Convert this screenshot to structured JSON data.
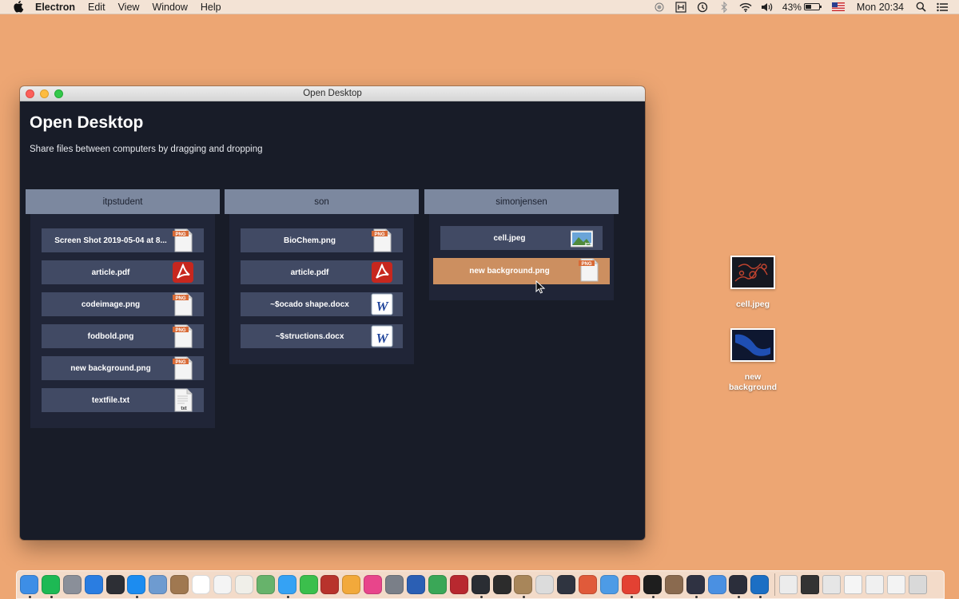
{
  "menubar": {
    "app_name": "Electron",
    "items": [
      "Edit",
      "View",
      "Window",
      "Help"
    ],
    "battery_percent": "43%",
    "battery_level": 0.43,
    "clock": "Mon 20:34",
    "status_icons": [
      "record-icon",
      "keyboard-icon",
      "time-machine-icon",
      "bluetooth-icon",
      "wifi-icon",
      "volume-icon"
    ]
  },
  "window": {
    "title": "Open Desktop",
    "heading": "Open Desktop",
    "subtitle": "Share files between computers by dragging and dropping"
  },
  "columns": [
    {
      "user": "itpstudent",
      "files": [
        {
          "name": "Screen Shot 2019-05-04 at 8...",
          "type": "png"
        },
        {
          "name": "article.pdf",
          "type": "pdf"
        },
        {
          "name": "codeimage.png",
          "type": "png"
        },
        {
          "name": "fodbold.png",
          "type": "png"
        },
        {
          "name": "new background.png",
          "type": "png"
        },
        {
          "name": "textfile.txt",
          "type": "txt"
        }
      ]
    },
    {
      "user": "son",
      "files": [
        {
          "name": "BioChem.png",
          "type": "png"
        },
        {
          "name": "article.pdf",
          "type": "pdf"
        },
        {
          "name": "~$ocado shape.docx",
          "type": "docx"
        },
        {
          "name": "~$structions.docx",
          "type": "docx"
        }
      ]
    },
    {
      "user": "simonjensen",
      "files": [
        {
          "name": "cell.jpeg",
          "type": "jpeg"
        },
        {
          "name": "new background.png",
          "type": "png",
          "dragging": true
        }
      ]
    }
  ],
  "icon_badges": {
    "png": "PNG",
    "txt": "txt",
    "docx": "W",
    "jpeg": "jpeg"
  },
  "desktop_icons": [
    {
      "label": "cell.jpeg",
      "kind": "image-thumbnail",
      "color": "#1b1e28"
    },
    {
      "label": "new background",
      "kind": "image-thumbnail",
      "color": "#13204a"
    }
  ],
  "dock": {
    "items": [
      {
        "name": "finder-icon",
        "color": "#3d8ee6",
        "running": true
      },
      {
        "name": "spotify-icon",
        "color": "#1db954",
        "running": true
      },
      {
        "name": "launchpad-icon",
        "color": "#8a8f99",
        "running": false
      },
      {
        "name": "safari-icon",
        "color": "#2a7de1",
        "running": false
      },
      {
        "name": "mission-control-icon",
        "color": "#2d2f35",
        "running": false
      },
      {
        "name": "safari-compass-icon",
        "color": "#1c8cf0",
        "running": true
      },
      {
        "name": "preview-icon",
        "color": "#6e9bd0",
        "running": false
      },
      {
        "name": "notes-icon",
        "color": "#a07850",
        "running": false
      },
      {
        "name": "calendar-icon",
        "color": "#ffffff",
        "running": false
      },
      {
        "name": "reminders-icon",
        "color": "#f4f4f4",
        "running": false
      },
      {
        "name": "stickies-icon",
        "color": "#f0efe9",
        "running": false
      },
      {
        "name": "maps-icon",
        "color": "#67b36b",
        "running": false
      },
      {
        "name": "messages-icon",
        "color": "#35a2f4",
        "running": true
      },
      {
        "name": "facetime-icon",
        "color": "#3bbf4c",
        "running": false
      },
      {
        "name": "photo-booth-icon",
        "color": "#b8332c",
        "running": false
      },
      {
        "name": "photos-icon",
        "color": "#f2a93b",
        "running": false
      },
      {
        "name": "itunes-icon",
        "color": "#e8458b",
        "running": false
      },
      {
        "name": "system-preferences-icon",
        "color": "#7a7f88",
        "running": false
      },
      {
        "name": "word-icon",
        "color": "#2b5fb4",
        "running": false
      },
      {
        "name": "sourcetree-icon",
        "color": "#3aa757",
        "running": false
      },
      {
        "name": "scrivener-icon",
        "color": "#b8282f",
        "running": false
      },
      {
        "name": "activity-monitor-icon",
        "color": "#2a2d33",
        "running": true
      },
      {
        "name": "p5-icon",
        "color": "#2c2c2c",
        "running": false
      },
      {
        "name": "archive-utility-icon",
        "color": "#a8865a",
        "running": true
      },
      {
        "name": "disk-utility-icon",
        "color": "#dcdcdc",
        "running": false
      },
      {
        "name": "xcode-icon",
        "color": "#2f3440",
        "running": false
      },
      {
        "name": "compass-icon",
        "color": "#e05a3a",
        "running": false
      },
      {
        "name": "shield-icon",
        "color": "#4d9be6",
        "running": false
      },
      {
        "name": "chrome-icon",
        "color": "#e34133",
        "running": true
      },
      {
        "name": "terminal-icon",
        "color": "#1e1e1e",
        "running": true
      },
      {
        "name": "hammer-icon",
        "color": "#8a6a4f",
        "running": false
      },
      {
        "name": "electron-icon",
        "color": "#2f3242",
        "running": true
      },
      {
        "name": "keynote-icon",
        "color": "#4a90e2",
        "running": false
      },
      {
        "name": "electron-app-icon",
        "color": "#2b2e3b",
        "running": true
      },
      {
        "name": "quicktime-icon",
        "color": "#1c6fc4",
        "running": true
      }
    ],
    "trailing_items": [
      {
        "name": "document-thumbnail-icon",
        "color": "#ececec"
      },
      {
        "name": "terminal-window-icon",
        "color": "#333333"
      },
      {
        "name": "window-thumbnail-icon",
        "color": "#e6e6e6"
      },
      {
        "name": "window-thumbnail-icon",
        "color": "#f5f5f5"
      },
      {
        "name": "window-thumbnail-icon",
        "color": "#f0f0f0"
      },
      {
        "name": "window-thumbnail-icon",
        "color": "#f3f3f3"
      },
      {
        "name": "trash-icon",
        "color": "#d9d9d9"
      }
    ]
  }
}
